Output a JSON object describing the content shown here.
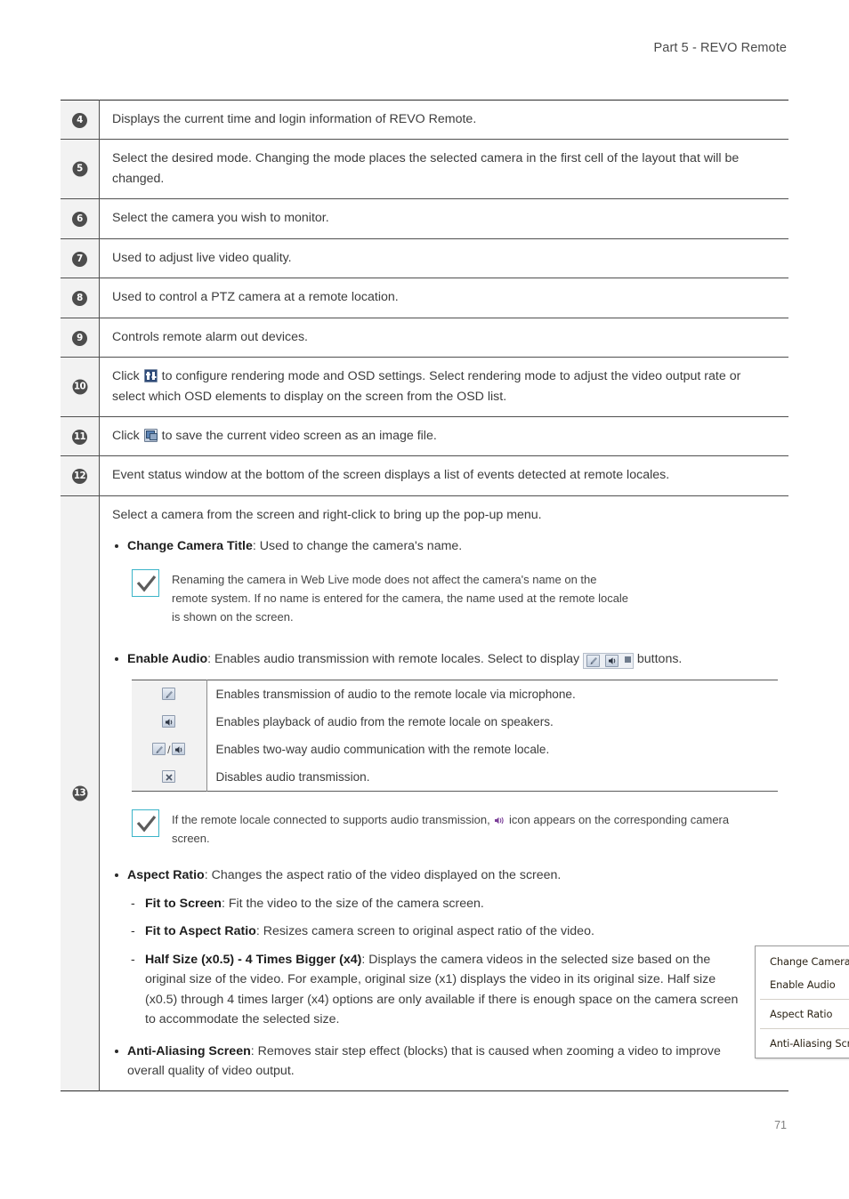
{
  "header": {
    "running_head": "Part 5 - REVO Remote"
  },
  "footer": {
    "page_number": "71"
  },
  "colors": {
    "note_border": "#3bb4c8",
    "number_circle": "#4d4d4d",
    "num_column_bg": "#f2f2f2",
    "render_icon": "#2f4b78",
    "speaker_purple": "#7b3f98"
  },
  "table": {
    "rows": [
      {
        "number": "4",
        "text": "Displays the current time and login information of REVO Remote."
      },
      {
        "number": "5",
        "text": "Select the desired mode. Changing the mode places the selected camera in the first cell of the layout that will be changed."
      },
      {
        "number": "6",
        "text": "Select the camera you wish to monitor."
      },
      {
        "number": "7",
        "text": "Used to adjust live video quality."
      },
      {
        "number": "8",
        "text": "Used to control a PTZ camera at a remote location."
      },
      {
        "number": "9",
        "text": "Controls remote alarm out devices."
      },
      {
        "number": "10",
        "text_before_icon": "Click",
        "icon": "render-settings-icon",
        "text_after_icon": "to configure rendering mode and OSD settings. Select rendering mode to adjust the video output rate or select which OSD elements to display on the screen from the OSD list."
      },
      {
        "number": "11",
        "text_before_icon": "Click",
        "icon": "save-image-icon",
        "text_after_icon": "to save the current video screen as an image file."
      },
      {
        "number": "12",
        "text": "Event status window at the bottom of the screen displays a list of events detected at remote locales."
      },
      {
        "number": "13"
      }
    ]
  },
  "item13": {
    "intro": "Select a camera from the screen and right-click to bring up the pop-up menu.",
    "popup_menu": {
      "items": [
        {
          "label": "Change Camera Title",
          "submenu": false
        },
        {
          "label": "Enable Audio",
          "submenu": false
        },
        {
          "label": "Aspect Ratio",
          "submenu": true
        },
        {
          "label": "Anti-Aliasing Screen",
          "submenu": false
        }
      ]
    },
    "change_camera_title": {
      "term": "Change Camera Title",
      "desc": ": Used to change the camera's name."
    },
    "note1": "Renaming the camera in Web Live mode does not affect the camera's name on the remote system. If no name is entered for the camera, the name used at the remote locale is shown on the screen.",
    "enable_audio": {
      "term": "Enable Audio",
      "desc_before": ": Enables audio transmission with remote locales. Select to display",
      "desc_after": "buttons."
    },
    "audio_table": {
      "rows": [
        {
          "icon": "microphone-icon",
          "desc": "Enables transmission of audio to the remote locale via microphone."
        },
        {
          "icon": "speaker-icon",
          "desc": "Enables playback of audio from the remote locale on speakers."
        },
        {
          "icon": "microphone-and-speaker-icon",
          "desc": "Enables two-way audio communication with the remote locale."
        },
        {
          "icon": "audio-disabled-icon",
          "desc": "Disables audio transmission."
        }
      ]
    },
    "note2_before": "If the remote locale connected to supports audio transmission,",
    "note2_after": "icon appears on the corresponding camera screen.",
    "aspect_ratio": {
      "term": "Aspect Ratio",
      "desc": ": Changes the aspect ratio of the video displayed on the screen.",
      "options": [
        {
          "term": "Fit to Screen",
          "desc": ": Fit the video to the size of the camera screen."
        },
        {
          "term": "Fit to Aspect Ratio",
          "desc": ": Resizes camera screen to original aspect ratio of the video."
        },
        {
          "term": "Half Size (x0.5) - 4 Times Bigger (x4)",
          "desc": ": Displays the camera videos in the selected size based on the original size of the video. For example, original size (x1) displays the video in its original size. Half size (x0.5) through 4 times larger (x4) options are only available if there is enough space on the camera screen to accommodate the selected size."
        }
      ]
    },
    "anti_aliasing": {
      "term": "Anti-Aliasing Screen",
      "desc": ": Removes stair step effect (blocks) that is caused when zooming a video to improve overall quality of video output."
    }
  }
}
